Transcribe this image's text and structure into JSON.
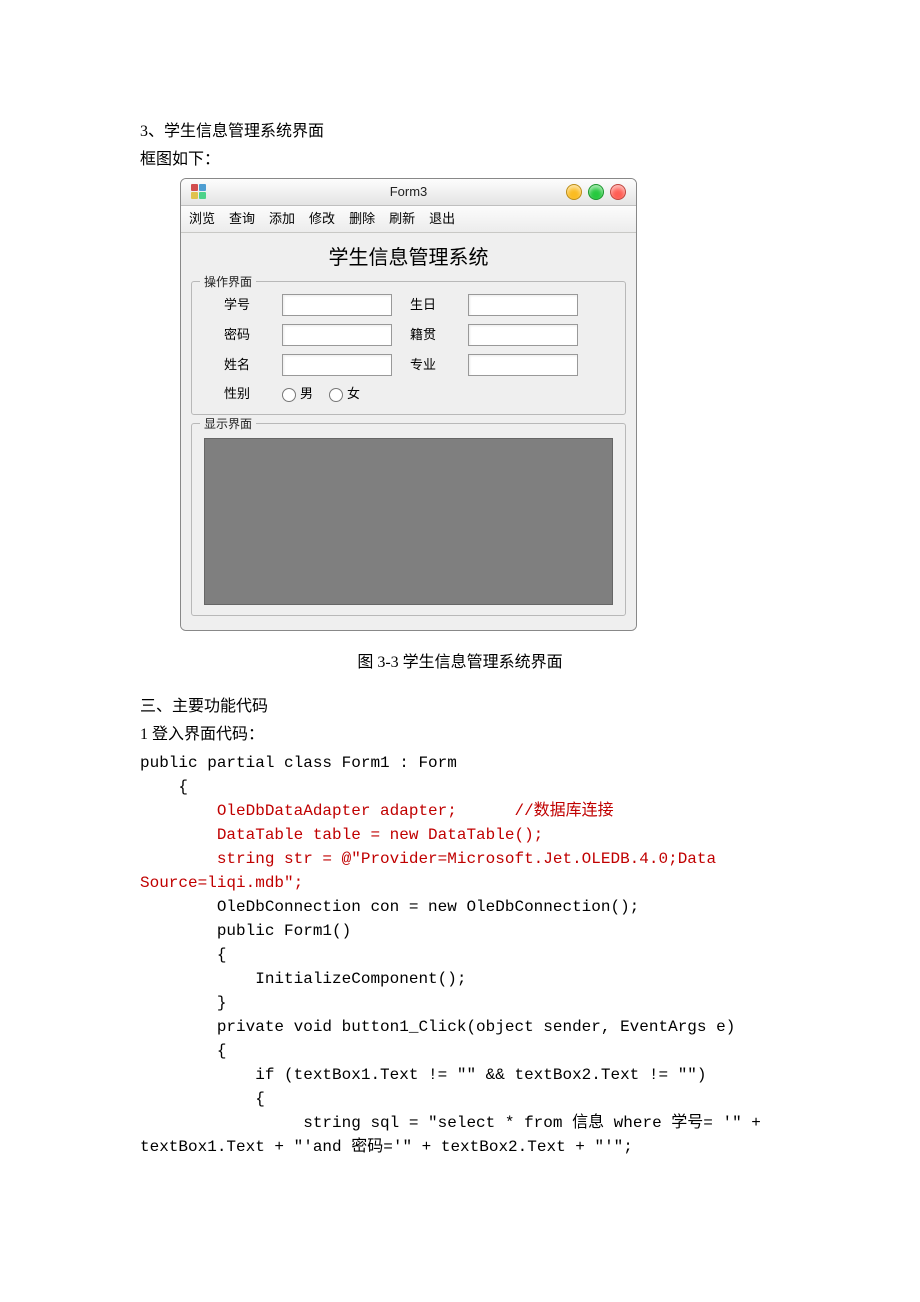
{
  "intro": {
    "line1": "3、学生信息管理系统界面",
    "line2": "框图如下："
  },
  "window": {
    "title": "Form3",
    "menubar": [
      "浏览",
      "查询",
      "添加",
      "修改",
      "删除",
      "刷新",
      "退出"
    ],
    "system_title": "学生信息管理系统",
    "group_operate_legend": "操作界面",
    "fields": {
      "id": "学号",
      "pw": "密码",
      "name": "姓名",
      "sex": "性别",
      "radio_m": "男",
      "radio_f": "女",
      "birth": "生日",
      "native": "籍贯",
      "major": "专业"
    },
    "group_display_legend": "显示界面"
  },
  "caption": "图 3-3 学生信息管理系统界面",
  "section3": {
    "heading": "三、主要功能代码",
    "sub1": "1 登入界面代码："
  },
  "code": {
    "l1": "public partial class Form1 : Form",
    "l2": "    {",
    "l3a": "        OleDbDataAdapter adapter;",
    "l3b": "      //数据库连接",
    "l4": "        DataTable table = new DataTable();",
    "l5": "        string str = @\"Provider=Microsoft.Jet.OLEDB.4.0;Data ",
    "l6": "Source=liqi.mdb\";",
    "l7": "        OleDbConnection con = new OleDbConnection();",
    "l8": "        public Form1()",
    "l9": "        {",
    "l10": "            InitializeComponent();",
    "l11": "        }",
    "l12": "        private void button1_Click(object sender, EventArgs e)",
    "l13": "        {",
    "l14": "            if (textBox1.Text != \"\" && textBox2.Text != \"\")",
    "l15": "            {",
    "l16": "                 string sql = \"select * from 信息 where 学号= '\" + ",
    "l17": "textBox1.Text + \"'and 密码='\" + textBox2.Text + \"'\";"
  }
}
